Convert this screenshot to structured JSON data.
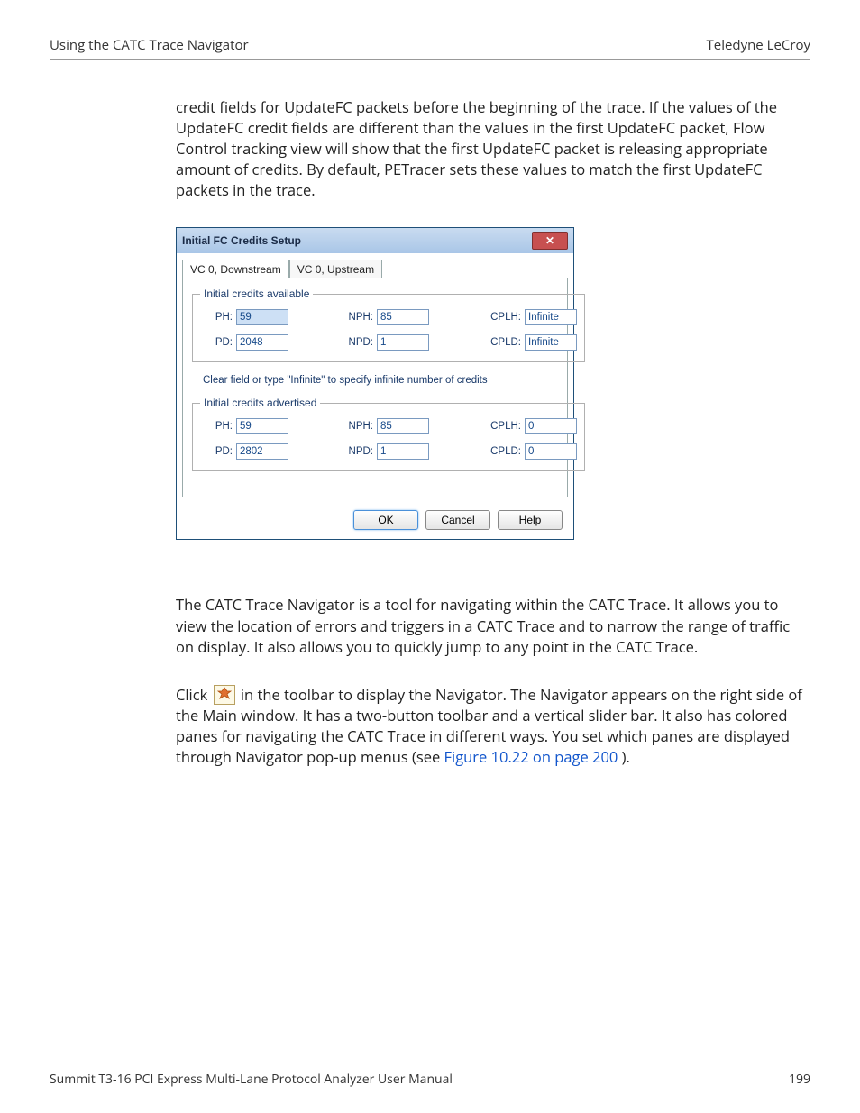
{
  "header": {
    "left": "Using the CATC Trace Navigator",
    "right": "Teledyne LeCroy"
  },
  "para_intro": "credit fields for UpdateFC packets before the beginning of the trace. If the values of the UpdateFC credit fields are different than the values in the first UpdateFC packet, Flow Control tracking view will show that the first UpdateFC packet is releasing appropriate amount of credits. By default, PETracer sets these values to match the first UpdateFC packets in the trace.",
  "dialog": {
    "title": "Initial FC Credits Setup",
    "close_symbol": "✕",
    "tabs": [
      "VC 0, Downstream",
      "VC 0, Upstream"
    ],
    "active_tab_index": 0,
    "group1_title": "Initial credits available",
    "group2_title": "Initial credits advertised",
    "labels": {
      "ph": "PH:",
      "nph": "NPH:",
      "cplh": "CPLH:",
      "pd": "PD:",
      "npd": "NPD:",
      "cpld": "CPLD:"
    },
    "available": {
      "ph": "59",
      "nph": "85",
      "cplh": "Infinite",
      "pd": "2048",
      "npd": "1",
      "cpld": "Infinite"
    },
    "hint": "Clear field or type \"Infinite\" to specify infinite number of credits",
    "advertised": {
      "ph": "59",
      "nph": "85",
      "cplh": "0",
      "pd": "2802",
      "npd": "1",
      "cpld": "0"
    },
    "buttons": {
      "ok": "OK",
      "cancel": "Cancel",
      "help": "Help"
    }
  },
  "para_nav": "The CATC Trace Navigator is a tool for navigating within the CATC Trace. It allows you to view the location of errors and triggers in a CATC Trace and to narrow the range of traffic on display. It also allows you to quickly jump to any point in the CATC Trace.",
  "para_click_pre": "Click ",
  "para_click_post": " in the toolbar to display the Navigator. The Navigator appears on the right side of the Main window. It has a two-button toolbar and a vertical slider bar. It also has colored panes for navigating the CATC Trace in different ways. You set which panes are displayed through Navigator pop-up menus (see ",
  "xref": "Figure 10.22 on page 200",
  "para_click_end": ").",
  "footer": {
    "left": "Summit T3-16 PCI Express Multi-Lane Protocol Analyzer User Manual",
    "right": "199"
  }
}
